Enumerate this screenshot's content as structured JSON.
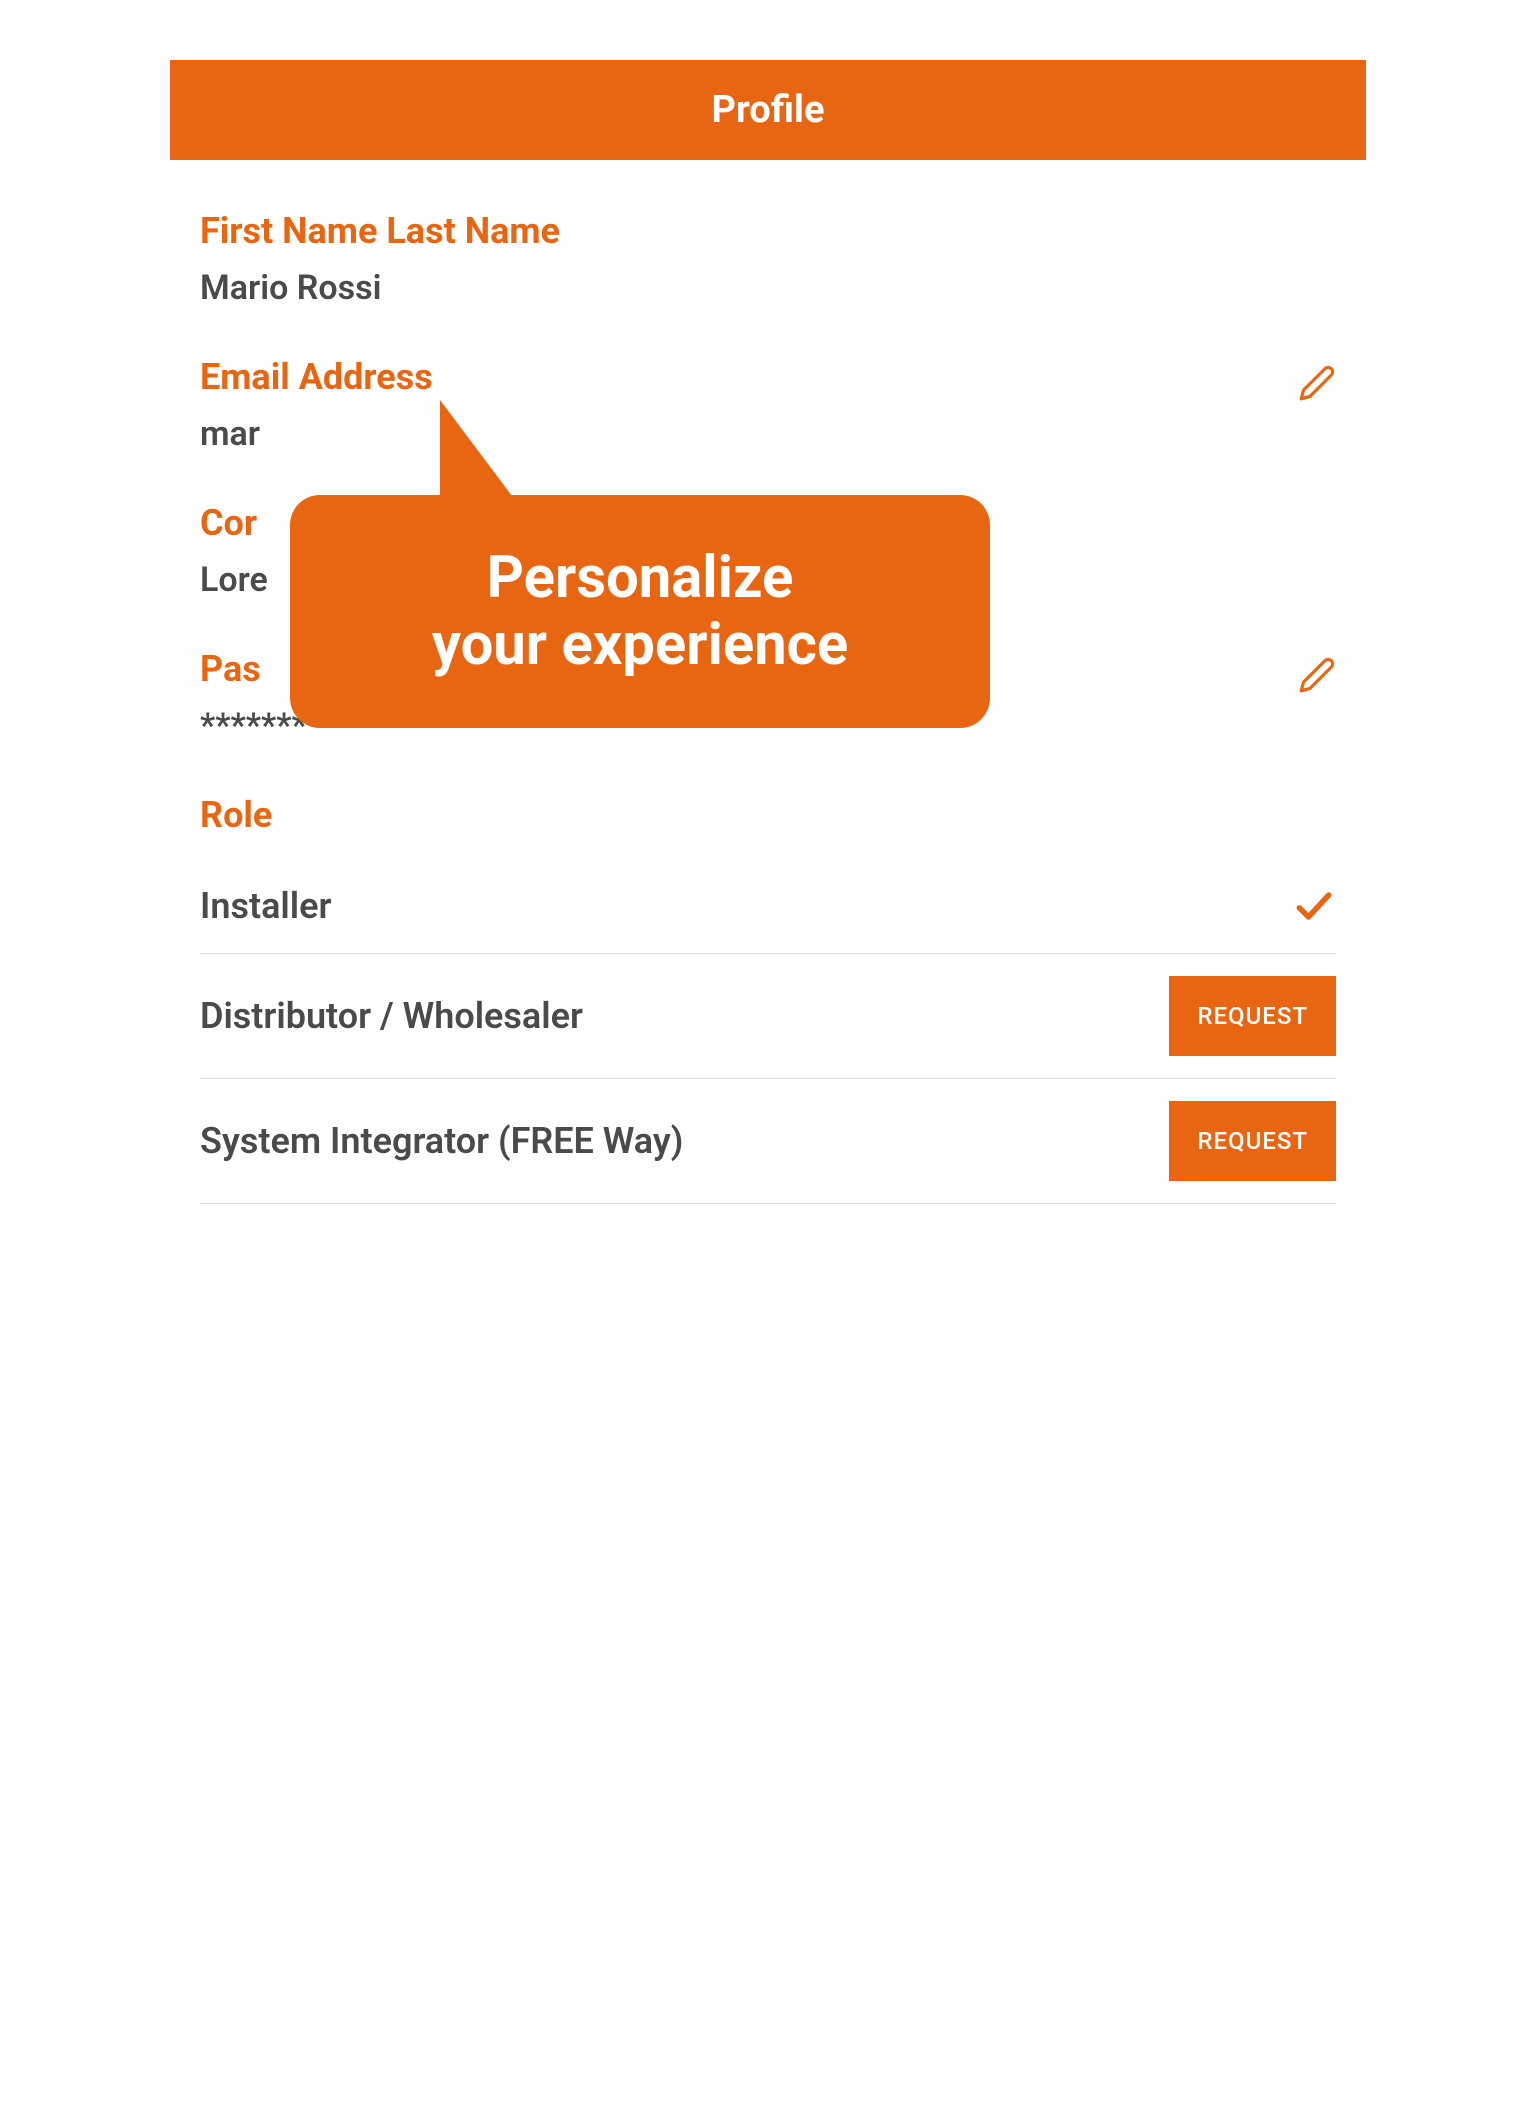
{
  "header": {
    "title": "Profile"
  },
  "fields": {
    "name": {
      "label": "First Name Last Name",
      "value": "Mario Rossi"
    },
    "email": {
      "label": "Email Address",
      "value": "mar"
    },
    "company": {
      "label": "Cor",
      "value": "Lore"
    },
    "password": {
      "label": "Pas",
      "value": "*******"
    }
  },
  "role": {
    "label": "Role",
    "items": [
      {
        "name": "Installer",
        "selected": true
      },
      {
        "name": "Distributor / Wholesaler",
        "button": "REQUEST"
      },
      {
        "name": "System Integrator (FREE Way)",
        "button": "REQUEST"
      }
    ]
  },
  "tooltip": {
    "line1": "Personalize",
    "line2": "your experience"
  }
}
